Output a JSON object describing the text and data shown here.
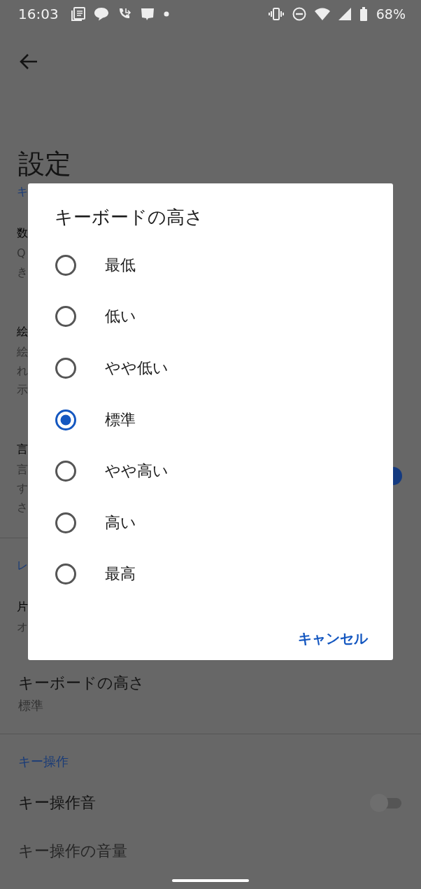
{
  "status_bar": {
    "time": "16:03",
    "battery": "68%"
  },
  "page": {
    "title": "設定"
  },
  "left_fragments": [
    {
      "kind": "header",
      "text": "キ"
    },
    {
      "kind": "title",
      "text": "数"
    },
    {
      "kind": "summary",
      "text": "Q"
    },
    {
      "kind": "summary",
      "text": "き"
    },
    {
      "kind": "title",
      "text": "絵"
    },
    {
      "kind": "summary",
      "text": "絵"
    },
    {
      "kind": "summary",
      "text": "れ"
    },
    {
      "kind": "summary",
      "text": "示"
    },
    {
      "kind": "title",
      "text": "言"
    },
    {
      "kind": "summary",
      "text": "言"
    },
    {
      "kind": "summary",
      "text": "す"
    },
    {
      "kind": "summary",
      "text": "さ"
    },
    {
      "kind": "header",
      "text": "レ"
    },
    {
      "kind": "title",
      "text": "片"
    },
    {
      "kind": "summary",
      "text": "オ"
    }
  ],
  "hidden_toggle": {
    "on": true
  },
  "dialog": {
    "title": "キーボードの高さ",
    "options": [
      {
        "label": "最低",
        "selected": false
      },
      {
        "label": "低い",
        "selected": false
      },
      {
        "label": "やや低い",
        "selected": false
      },
      {
        "label": "標準",
        "selected": true
      },
      {
        "label": "やや高い",
        "selected": false
      },
      {
        "label": "高い",
        "selected": false
      },
      {
        "label": "最高",
        "selected": false
      }
    ],
    "buttons": [
      "キャンセル"
    ]
  },
  "below": {
    "item": {
      "title": "キーボードの高さ",
      "summary": "標準"
    },
    "section": {
      "header": "キー操作",
      "items": [
        {
          "title": "キー操作音",
          "on": false
        },
        {
          "title": "キー操作の音量"
        }
      ]
    }
  }
}
